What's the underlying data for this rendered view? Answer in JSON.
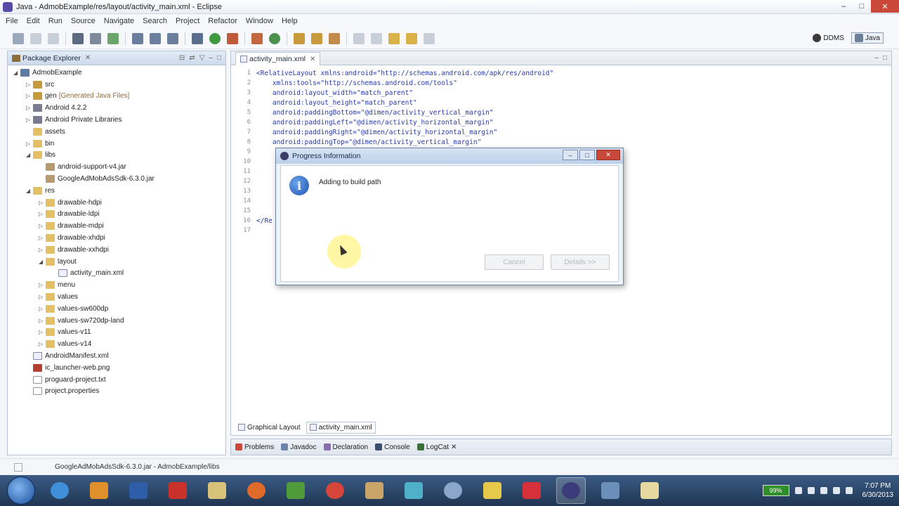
{
  "window": {
    "title": "Java - AdmobExample/res/layout/activity_main.xml - Eclipse",
    "controls": [
      "–",
      "□",
      "✕"
    ]
  },
  "menu": [
    "File",
    "Edit",
    "Run",
    "Source",
    "Navigate",
    "Search",
    "Project",
    "Refactor",
    "Window",
    "Help"
  ],
  "perspectives": [
    {
      "label": "DDMS"
    },
    {
      "label": "Java"
    }
  ],
  "explorer": {
    "tab_label": "Package Explorer",
    "items": [
      {
        "label": "AdmobExample",
        "arrow": "◢",
        "icon": "project",
        "indent": 0
      },
      {
        "label": "src",
        "arrow": "▷",
        "icon": "pkg",
        "indent": 1
      },
      {
        "label": "gen",
        "hint": "[Generated Java Files]",
        "arrow": "▷",
        "icon": "pkg",
        "indent": 1
      },
      {
        "label": "Android 4.2.2",
        "arrow": "▷",
        "icon": "lib",
        "indent": 1
      },
      {
        "label": "Android Private Libraries",
        "arrow": "▷",
        "icon": "lib",
        "indent": 1
      },
      {
        "label": "assets",
        "arrow": "",
        "icon": "folder",
        "indent": 1
      },
      {
        "label": "bin",
        "arrow": "▷",
        "icon": "folder",
        "indent": 1
      },
      {
        "label": "libs",
        "arrow": "◢",
        "icon": "folder",
        "indent": 1
      },
      {
        "label": "android-support-v4.jar",
        "arrow": "",
        "icon": "jar",
        "indent": 2
      },
      {
        "label": "GoogleAdMobAdsSdk-6.3.0.jar",
        "arrow": "",
        "icon": "jar",
        "indent": 2
      },
      {
        "label": "res",
        "arrow": "◢",
        "icon": "folder",
        "indent": 1
      },
      {
        "label": "drawable-hdpi",
        "arrow": "▷",
        "icon": "folder",
        "indent": 2
      },
      {
        "label": "drawable-ldpi",
        "arrow": "▷",
        "icon": "folder",
        "indent": 2
      },
      {
        "label": "drawable-mdpi",
        "arrow": "▷",
        "icon": "folder",
        "indent": 2
      },
      {
        "label": "drawable-xhdpi",
        "arrow": "▷",
        "icon": "folder",
        "indent": 2
      },
      {
        "label": "drawable-xxhdpi",
        "arrow": "▷",
        "icon": "folder",
        "indent": 2
      },
      {
        "label": "layout",
        "arrow": "◢",
        "icon": "folder",
        "indent": 2
      },
      {
        "label": "activity_main.xml",
        "arrow": "",
        "icon": "xml",
        "indent": 3
      },
      {
        "label": "menu",
        "arrow": "▷",
        "icon": "folder",
        "indent": 2
      },
      {
        "label": "values",
        "arrow": "▷",
        "icon": "folder",
        "indent": 2
      },
      {
        "label": "values-sw600dp",
        "arrow": "▷",
        "icon": "folder",
        "indent": 2
      },
      {
        "label": "values-sw720dp-land",
        "arrow": "▷",
        "icon": "folder",
        "indent": 2
      },
      {
        "label": "values-v11",
        "arrow": "▷",
        "icon": "folder",
        "indent": 2
      },
      {
        "label": "values-v14",
        "arrow": "▷",
        "icon": "folder",
        "indent": 2
      },
      {
        "label": "AndroidManifest.xml",
        "arrow": "",
        "icon": "xml",
        "indent": 1
      },
      {
        "label": "ic_launcher-web.png",
        "arrow": "",
        "icon": "png",
        "indent": 1
      },
      {
        "label": "proguard-project.txt",
        "arrow": "",
        "icon": "file",
        "indent": 1
      },
      {
        "label": "project.properties",
        "arrow": "",
        "icon": "file",
        "indent": 1
      }
    ]
  },
  "editor": {
    "tab_label": "activity_main.xml",
    "lines": [
      {
        "n": "1",
        "text": "<RelativeLayout xmlns:android=\"http://schemas.android.com/apk/res/android\""
      },
      {
        "n": "2",
        "text": "    xmlns:tools=\"http://schemas.android.com/tools\""
      },
      {
        "n": "3",
        "text": "    android:layout_width=\"match_parent\""
      },
      {
        "n": "4",
        "text": "    android:layout_height=\"match_parent\""
      },
      {
        "n": "5",
        "text": "    android:paddingBottom=\"@dimen/activity_vertical_margin\""
      },
      {
        "n": "6",
        "text": "    android:paddingLeft=\"@dimen/activity_horizontal_margin\""
      },
      {
        "n": "7",
        "text": "    android:paddingRight=\"@dimen/activity_horizontal_margin\""
      },
      {
        "n": "8",
        "text": "    android:paddingTop=\"@dimen/activity_vertical_margin\""
      },
      {
        "n": "9",
        "text": ""
      },
      {
        "n": "10",
        "text": ""
      },
      {
        "n": "11",
        "text": ""
      },
      {
        "n": "12",
        "text": ""
      },
      {
        "n": "13",
        "text": ""
      },
      {
        "n": "14",
        "text": ""
      },
      {
        "n": "15",
        "text": ""
      },
      {
        "n": "16",
        "text": "</Re"
      },
      {
        "n": "17",
        "text": ""
      }
    ],
    "bottom_tabs": [
      "Graphical Layout",
      "activity_main.xml"
    ]
  },
  "bottom_views": [
    "Problems",
    "Javadoc",
    "Declaration",
    "Console",
    "LogCat"
  ],
  "status": {
    "text": "GoogleAdMobAdsSdk-6.3.0.jar - AdmobExample/libs"
  },
  "dialog": {
    "title": "Progress Information",
    "message": "Adding to build path",
    "cancel_label": "Cancel",
    "details_label": "Details >>"
  },
  "taskbar": {
    "battery": "99%",
    "time": "7:07 PM",
    "date": "6/30/2013"
  }
}
